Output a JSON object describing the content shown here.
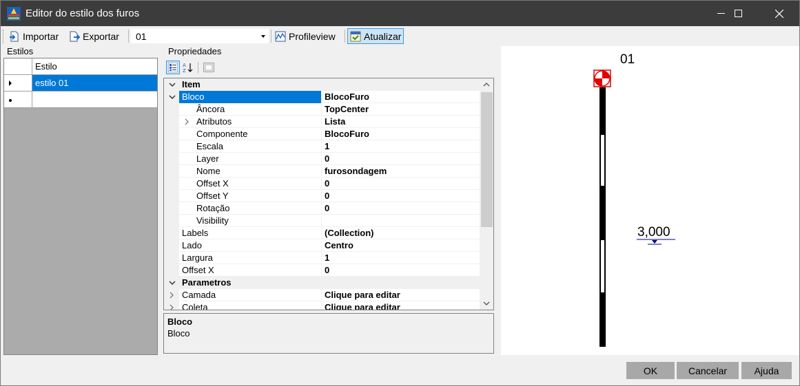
{
  "window": {
    "title": "Editor do estilo dos furos"
  },
  "toolbar": {
    "importar_label": "Importar",
    "exportar_label": "Exportar",
    "style_combo_value": "01",
    "profileview_label": "Profileview",
    "atualizar_label": "Atualizar"
  },
  "estilos": {
    "group_label": "Estilos",
    "column_header": "Estilo",
    "rows": [
      "estilo 01",
      ""
    ]
  },
  "propriedades": {
    "group_label": "Propriedades",
    "rows": [
      {
        "name": "Item",
        "value": ""
      },
      {
        "name": "Bloco",
        "value": "BlocoFuro"
      },
      {
        "name": "Âncora",
        "value": "TopCenter"
      },
      {
        "name": "Atributos",
        "value": "Lista"
      },
      {
        "name": "Componente",
        "value": "BlocoFuro"
      },
      {
        "name": "Escala",
        "value": "1"
      },
      {
        "name": "Layer",
        "value": "0"
      },
      {
        "name": "Nome",
        "value": "furosondagem"
      },
      {
        "name": "Offset X",
        "value": "0"
      },
      {
        "name": "Offset Y",
        "value": "0"
      },
      {
        "name": "Rotação",
        "value": "0"
      },
      {
        "name": "Visibility",
        "value": ""
      },
      {
        "name": "Labels",
        "value": "(Collection)"
      },
      {
        "name": "Lado",
        "value": "Centro"
      },
      {
        "name": "Largura",
        "value": "1"
      },
      {
        "name": "Offset X",
        "value": "0"
      },
      {
        "name": "Parametros",
        "value": ""
      },
      {
        "name": "Camada",
        "value": "Clique para editar"
      },
      {
        "name": "Coleta",
        "value": "Clique para editar"
      }
    ],
    "description_title": "Bloco",
    "description_text": "Bloco"
  },
  "preview": {
    "title": "01",
    "level_label": "3,000"
  },
  "footer": {
    "ok_label": "OK",
    "cancel_label": "Cancelar",
    "help_label": "Ajuda"
  },
  "colors": {
    "titlebar": "#3c3c3c",
    "selection": "#0078d7",
    "footer_button": "#a8a8a8",
    "marker_red": "#e00000"
  }
}
